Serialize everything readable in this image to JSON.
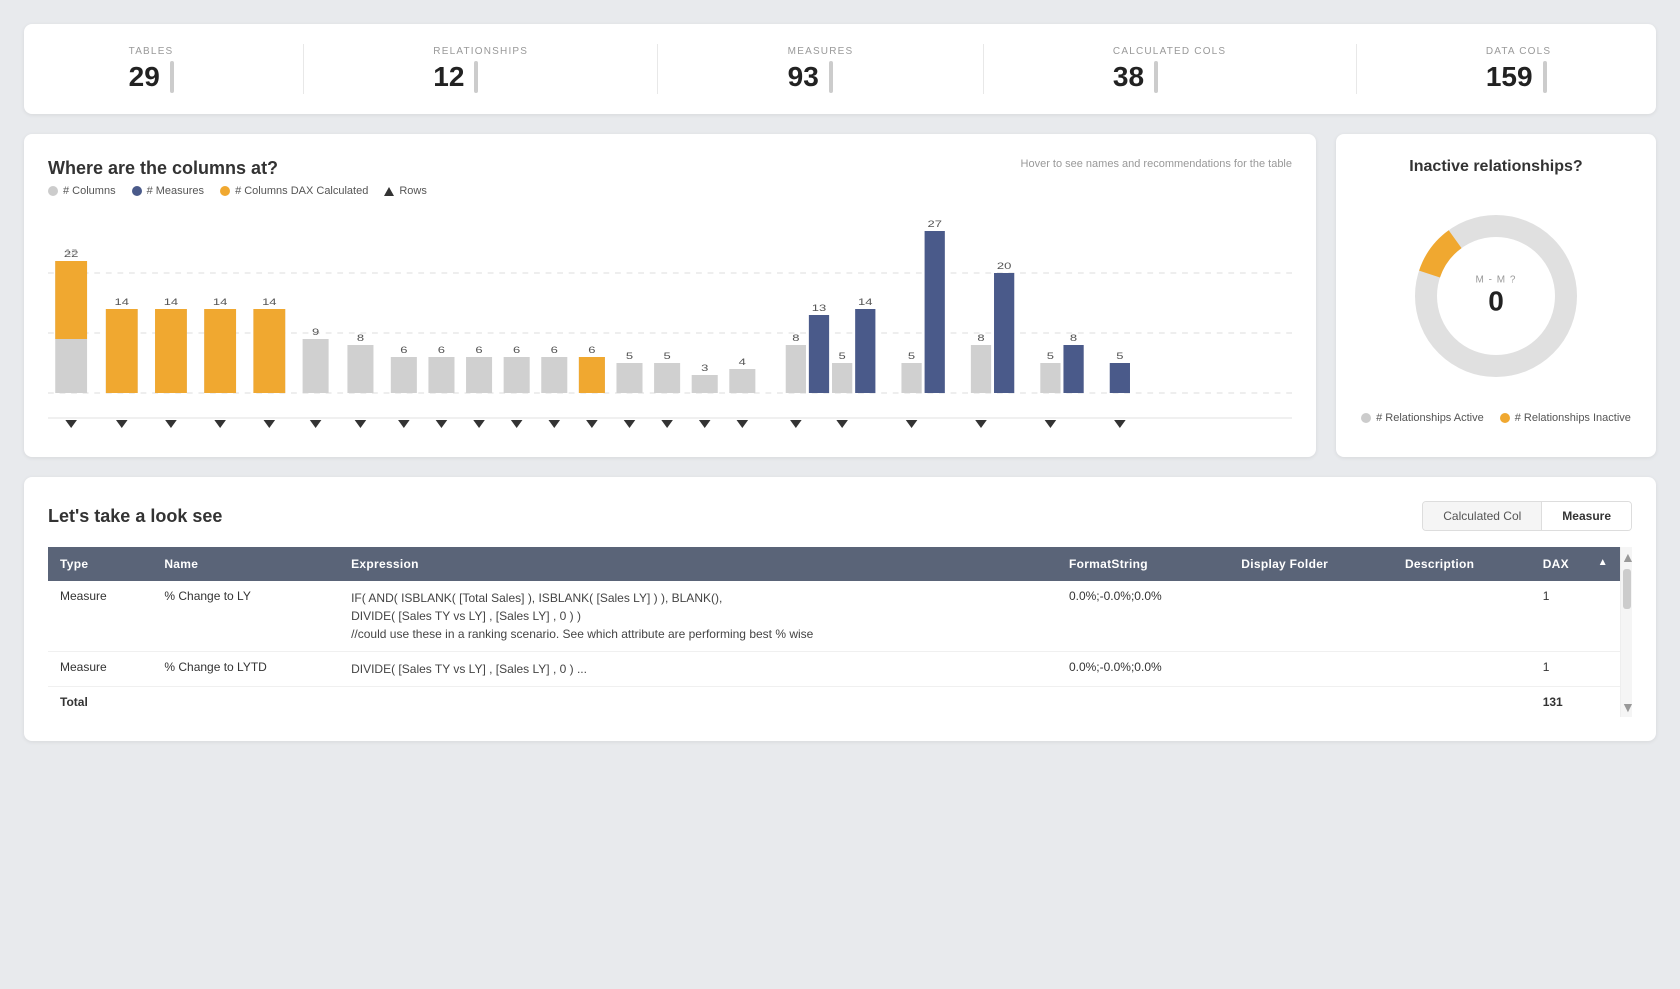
{
  "stats": {
    "items": [
      {
        "label": "TABLES",
        "value": "29"
      },
      {
        "label": "RELATIONSHIPS",
        "value": "12"
      },
      {
        "label": "MEASURES",
        "value": "93"
      },
      {
        "label": "CALCULATED COLS",
        "value": "38"
      },
      {
        "label": "DATA COLS",
        "value": "159"
      }
    ]
  },
  "chart": {
    "title": "Where are the columns at?",
    "subtitle": "Hover to see names and recommendations for the table",
    "legend": [
      {
        "label": "# Columns",
        "type": "dot",
        "color": "#ccc"
      },
      {
        "label": "# Measures",
        "type": "dot",
        "color": "#4a5a8a"
      },
      {
        "label": "# Columns DAX Calculated",
        "type": "dot",
        "color": "#f0a830"
      },
      {
        "label": "Rows",
        "type": "triangle",
        "color": "#333"
      }
    ],
    "bars": [
      {
        "col": 22,
        "measure": 0,
        "dax": 13,
        "rows": true
      },
      {
        "col": 14,
        "measure": 0,
        "dax": 14,
        "rows": true
      },
      {
        "col": 14,
        "measure": 0,
        "dax": 14,
        "rows": true
      },
      {
        "col": 14,
        "measure": 0,
        "dax": 14,
        "rows": true
      },
      {
        "col": 14,
        "measure": 0,
        "dax": 14,
        "rows": true
      },
      {
        "col": 9,
        "measure": 0,
        "dax": 0,
        "rows": true
      },
      {
        "col": 8,
        "measure": 0,
        "dax": 0,
        "rows": true
      },
      {
        "col": 6,
        "measure": 0,
        "dax": 0,
        "rows": true
      },
      {
        "col": 6,
        "measure": 0,
        "dax": 0,
        "rows": true
      },
      {
        "col": 6,
        "measure": 0,
        "dax": 0,
        "rows": true
      },
      {
        "col": 6,
        "measure": 0,
        "dax": 0,
        "rows": true
      },
      {
        "col": 6,
        "measure": 0,
        "dax": 0,
        "rows": true
      },
      {
        "col": 6,
        "measure": 0,
        "dax": 6,
        "rows": true
      },
      {
        "col": 5,
        "measure": 0,
        "dax": 0,
        "rows": true
      },
      {
        "col": 5,
        "measure": 0,
        "dax": 0,
        "rows": true
      },
      {
        "col": 3,
        "measure": 0,
        "dax": 0,
        "rows": true
      },
      {
        "col": 4,
        "measure": 0,
        "dax": 0,
        "rows": true
      },
      {
        "col": 8,
        "measure": 13,
        "dax": 0,
        "rows": true
      },
      {
        "col": 5,
        "measure": 14,
        "dax": 0,
        "rows": true
      },
      {
        "col": 5,
        "measure": 27,
        "dax": 0,
        "rows": true
      },
      {
        "col": 8,
        "measure": 20,
        "dax": 0,
        "rows": true
      },
      {
        "col": 5,
        "measure": 8,
        "dax": 0,
        "rows": true
      },
      {
        "col": 0,
        "measure": 5,
        "dax": 0,
        "rows": true
      }
    ]
  },
  "donut": {
    "title": "Inactive relationships?",
    "center_label": "M - M ?",
    "center_value": "0",
    "active_pct": 100,
    "inactive_pct": 0,
    "legend_active": "# Relationships Active",
    "legend_inactive": "# Relationships Inactive",
    "color_active": "#ccc",
    "color_inactive": "#f0a830"
  },
  "table_section": {
    "title": "Let's take a look see",
    "toggle_calculated": "Calculated Col",
    "toggle_measure": "Measure",
    "active_toggle": "Measure",
    "columns": [
      {
        "key": "type",
        "label": "Type"
      },
      {
        "key": "name",
        "label": "Name"
      },
      {
        "key": "expression",
        "label": "Expression"
      },
      {
        "key": "formatstring",
        "label": "FormatString"
      },
      {
        "key": "displayfolder",
        "label": "Display Folder"
      },
      {
        "key": "description",
        "label": "Description"
      },
      {
        "key": "dax",
        "label": "DAX"
      }
    ],
    "rows": [
      {
        "type": "Measure",
        "name": "% Change to LY",
        "expression": "IF( AND( ISBLANK( [Total Sales] ), ISBLANK( [Sales LY] ) ), BLANK(),\nDIVIDE( [Sales TY vs LY] , [Sales LY] , 0 ) )\n//could use these in a ranking scenario. See which attribute are performing best % wise",
        "formatstring": "0.0%;-0.0%;0.0%",
        "displayfolder": "",
        "description": "",
        "dax": "1"
      },
      {
        "type": "Measure",
        "name": "% Change to LYTD",
        "expression": "DIVIDE( [Sales TY vs LY] , [Sales LY] , 0 ) ...",
        "formatstring": "0.0%;-0.0%;0.0%",
        "displayfolder": "",
        "description": "",
        "dax": "1"
      }
    ],
    "total_label": "Total",
    "total_dax": "131"
  }
}
